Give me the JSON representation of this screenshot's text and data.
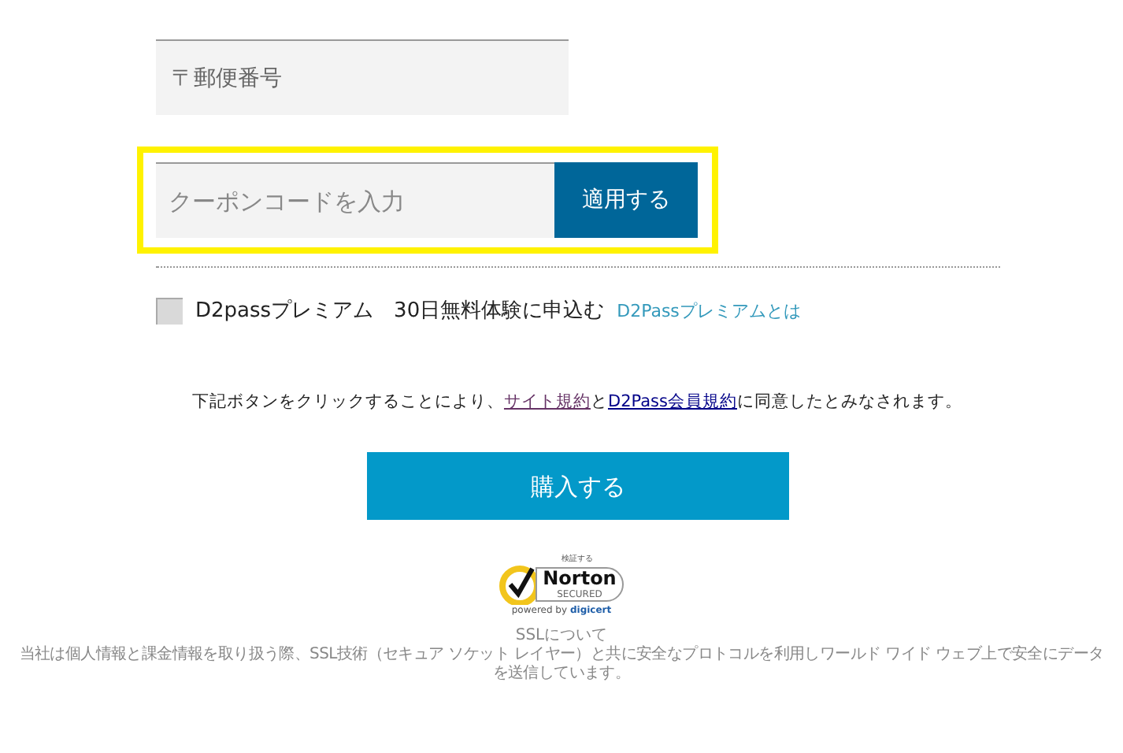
{
  "postal_field": {
    "placeholder": "〒郵便番号"
  },
  "coupon": {
    "highlight": true,
    "placeholder": "クーポンコードを入力",
    "button": "適用する"
  },
  "premium": {
    "checked": false,
    "label": "D2passプレミアム　30日無料体験に申込む",
    "link": "D2Passプレミアムとは"
  },
  "agreement": {
    "before": "下記ボタンをクリックすることにより、",
    "link_1": "サイト規約",
    "middle": "と",
    "link_2": "D2Pass会員規約",
    "after": "に同意したとみなされます。"
  },
  "purchase_button": "購入する",
  "badge": {
    "caption": "検証する",
    "brand": "Norton",
    "secured": "SECURED",
    "powered": "powered by",
    "vendor": "digicert"
  },
  "ssl": {
    "title": "SSLについて",
    "lines": [
      "当社は個人情報と課金情報を取り扱う際、SSL技術（セキュア ソケット レイヤー）と共に安全なプロトコルを利用しワールド ワイド ウェブ上で安全にデータ",
      "を送信しています。"
    ]
  }
}
